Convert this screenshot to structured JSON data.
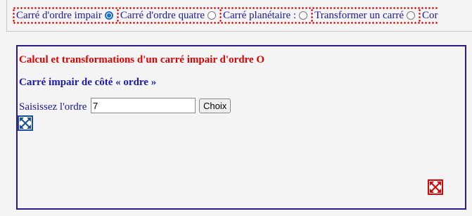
{
  "nav": {
    "items": [
      {
        "label": "Carré d'ordre impair",
        "checked": true
      },
      {
        "label": "Carré d'ordre quatre",
        "checked": false
      },
      {
        "label": "Carré planétaire :",
        "checked": false
      },
      {
        "label": "Transformer un carré",
        "checked": false
      },
      {
        "label": "Cor",
        "checked": false
      }
    ]
  },
  "panel": {
    "title": "Calcul et transformations d'un carré impair d'ordre O",
    "subtitle": "Carré impair de côté « ordre »",
    "order_label": "Saisissez l'ordre",
    "order_value": "7",
    "choix_label": "Choix"
  },
  "colors": {
    "title": "#e00000",
    "subtitle": "#1a1ab0",
    "panel_border": "#2a1a8a",
    "radio_selected": "#1a6fd0"
  },
  "icons": {
    "expand_blue": "expand-arrows-icon",
    "expand_red": "expand-arrows-icon"
  }
}
